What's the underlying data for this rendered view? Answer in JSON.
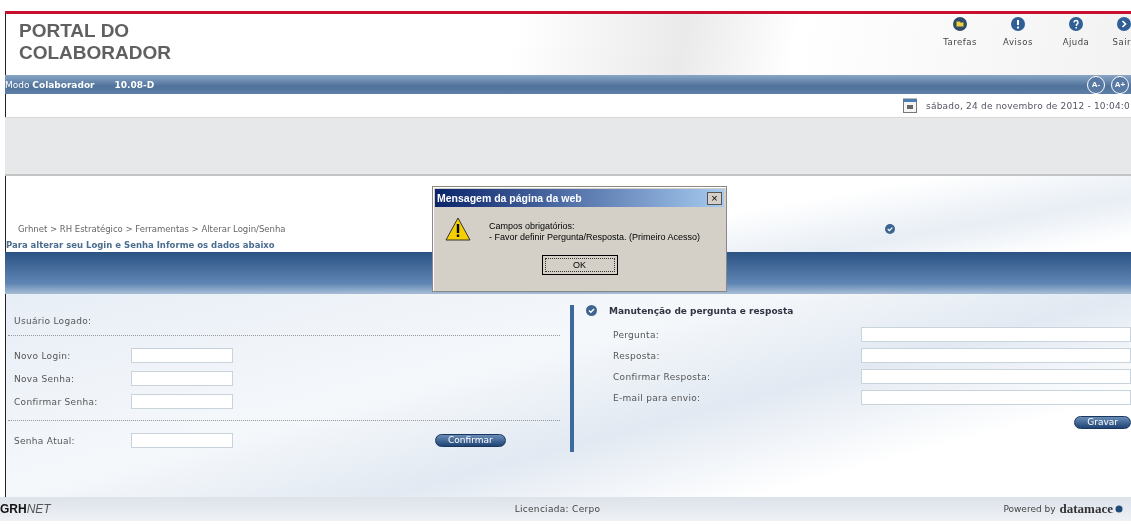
{
  "header": {
    "title_lines": [
      "PORTAL DO",
      "COLABORADOR"
    ],
    "actions": [
      {
        "kind": "tasks",
        "label": "Tarefas"
      },
      {
        "kind": "notices",
        "label": "Avisos"
      },
      {
        "kind": "help",
        "label": "Ajuda"
      },
      {
        "kind": "exit",
        "label": "Sair"
      }
    ]
  },
  "mode_bar": {
    "mode": "Modo **Colaborador**",
    "version": "10.08-D",
    "font_buttons": [
      "A-",
      "A+"
    ]
  },
  "date": "sábado, 24 de novembro de 2012 - 10:04:0",
  "breadcrumb": "Grhnet > RH Estratégico > Ferramentas > Alterar Login/Senha",
  "instructions": "Para alterar seu Login e Senha Informe os dados abaixo",
  "login_form": {
    "logged_user_label": "Usuário Logado:",
    "groups": [
      [
        {
          "label": "Novo Login:"
        },
        {
          "label": "Nova Senha:"
        },
        {
          "label": "Confirmar Senha:"
        }
      ],
      [
        {
          "label": "Senha Atual:"
        }
      ]
    ],
    "button": "Confirmar"
  },
  "question_form": {
    "title": "Manutenção de pergunta e resposta",
    "fields": [
      {
        "label": "Pergunta:"
      },
      {
        "label": "Resposta:"
      },
      {
        "label": "Confirmar Resposta:"
      },
      {
        "label": "E-mail para envio:"
      }
    ],
    "button": "Gravar"
  },
  "footer": {
    "logo_bold": "GRH",
    "logo_light": "NET",
    "license": "Licenciada: Cerpo",
    "powered_by": "Powered by",
    "brand": "datamace"
  },
  "dialog": {
    "title": "Mensagem da página da web",
    "close": "×",
    "lines": [
      "Campos obrigatórios:",
      "- Favor definir Pergunta/Resposta. (Primeiro Acesso)"
    ],
    "button": "OK"
  }
}
